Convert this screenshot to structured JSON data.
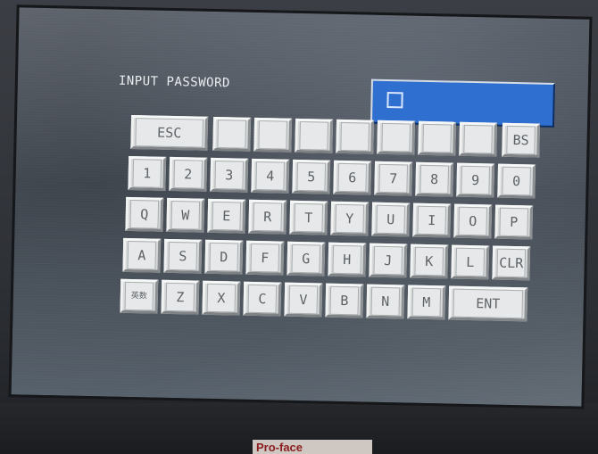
{
  "screen": {
    "prompt": "INPUT PASSWORD",
    "password_value": ""
  },
  "keypad": {
    "rows": [
      [
        "ESC",
        "",
        "",
        "",
        "",
        "",
        "",
        "",
        "BS"
      ],
      [
        "1",
        "2",
        "3",
        "4",
        "5",
        "6",
        "7",
        "8",
        "9",
        "0"
      ],
      [
        "Q",
        "W",
        "E",
        "R",
        "T",
        "Y",
        "U",
        "I",
        "O",
        "P"
      ],
      [
        "A",
        "S",
        "D",
        "F",
        "G",
        "H",
        "J",
        "K",
        "L",
        "CLR"
      ],
      [
        "英数",
        "Z",
        "X",
        "C",
        "V",
        "B",
        "N",
        "M",
        "ENT"
      ]
    ]
  },
  "device": {
    "brand": "Pro-face"
  },
  "colors": {
    "field": "#2f6fd0",
    "key_face": "#e6e8e9",
    "key_text": "#5d6266",
    "screen_bg": "#444a52"
  }
}
